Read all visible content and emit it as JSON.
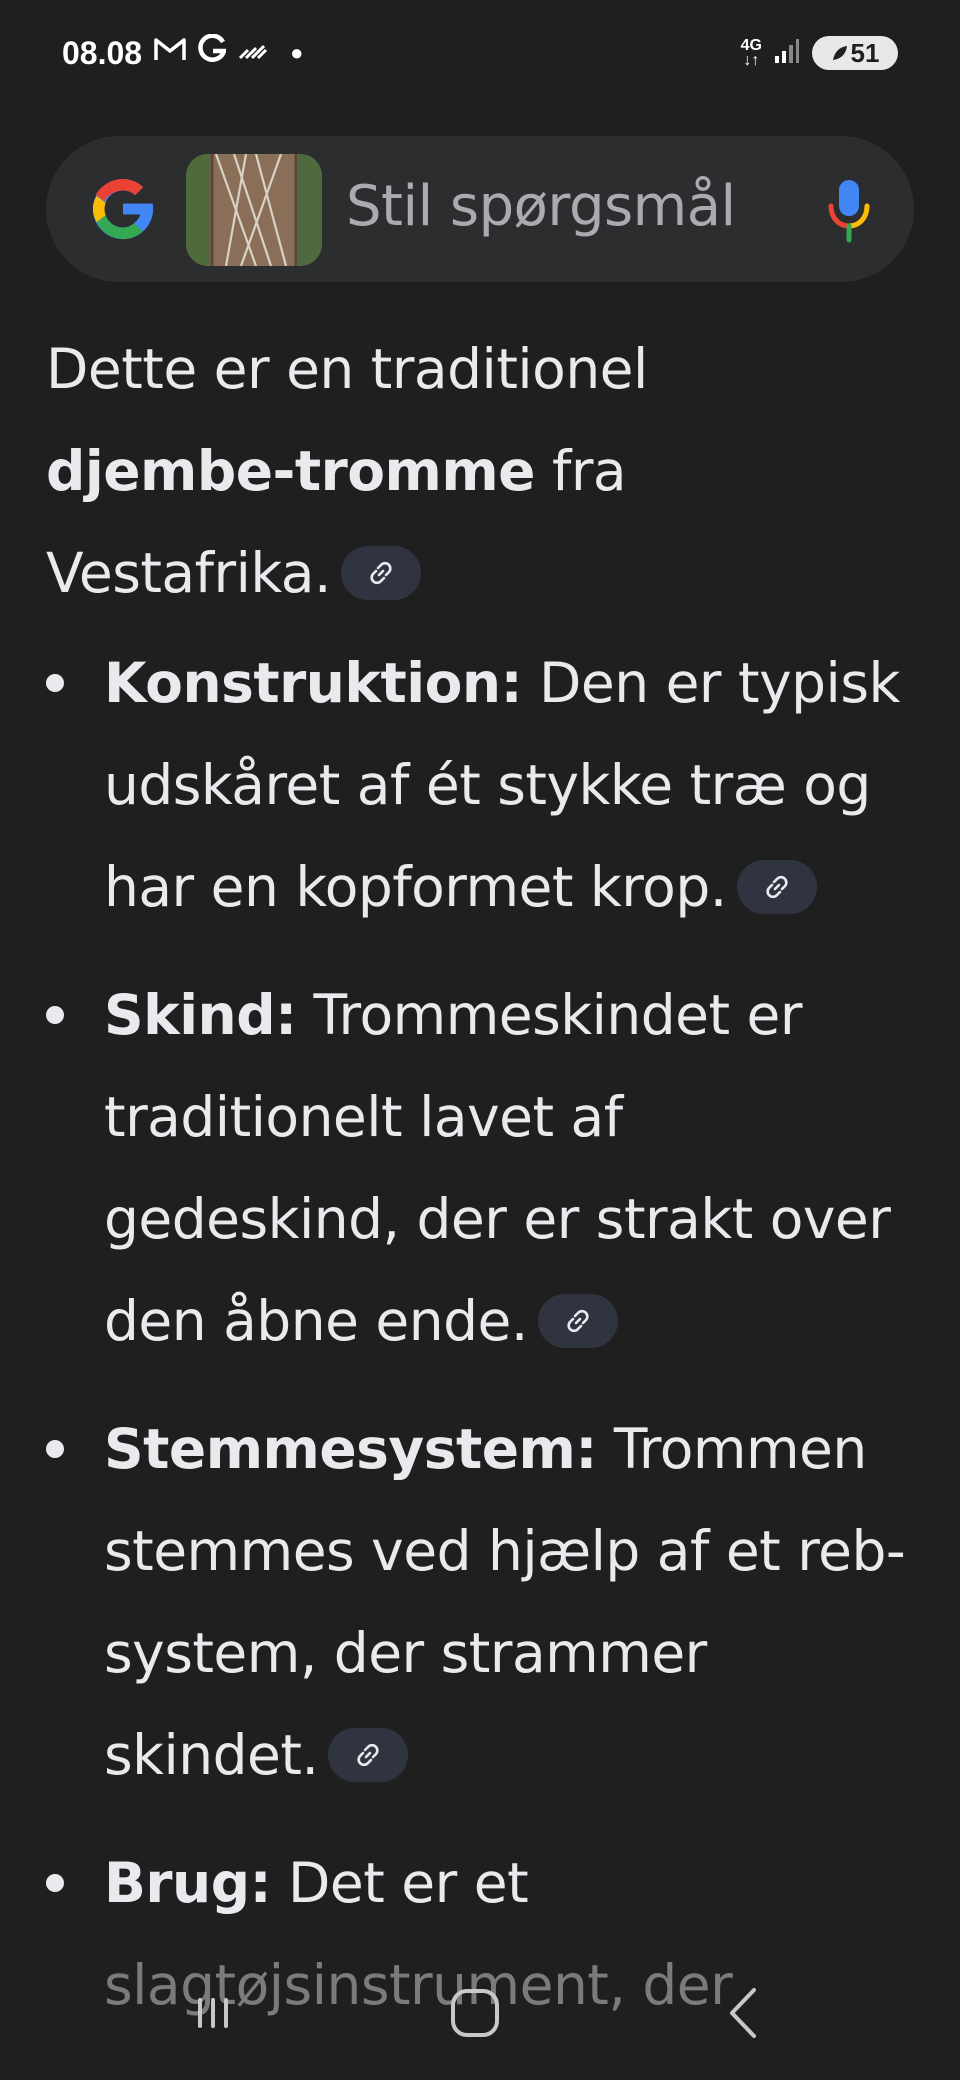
{
  "status_bar": {
    "time": "08.08",
    "network": "4G",
    "battery": "51",
    "icons": [
      "gmail-icon",
      "google-g-icon",
      "wifi-calling-icon",
      "dot-icon",
      "signal-icon",
      "battery-icon"
    ]
  },
  "search": {
    "placeholder": "Stil spørgsmål",
    "icons": [
      "google-logo",
      "image-thumbnail",
      "mic-icon"
    ]
  },
  "answer": {
    "intro_pre": "Dette er en traditionel ",
    "intro_bold": "djembe-tromme",
    "intro_post": " fra Vestafrika.",
    "points": [
      {
        "title": "Konstruktion:",
        "text": " Den er typisk udskåret af ét stykke træ og har en kopformet krop."
      },
      {
        "title": "Skind:",
        "text": " Trommeskindet er traditionelt lavet af gedeskind, der er strakt over den åbne ende."
      },
      {
        "title": "Stemmesystem:",
        "text": " Trommen stemmes ved hjælp af et reb-system, der strammer skindet."
      },
      {
        "title": "Brug:",
        "text": " Det er et slagtøjsinstrument, der"
      }
    ]
  },
  "nav": {
    "buttons": [
      "recent-apps-icon",
      "home-icon",
      "back-icon"
    ]
  },
  "colors": {
    "background": "#1f1f1f",
    "search_bg": "#2c2d2f",
    "text": "#e8eaed",
    "chip_bg": "#2f3440"
  }
}
